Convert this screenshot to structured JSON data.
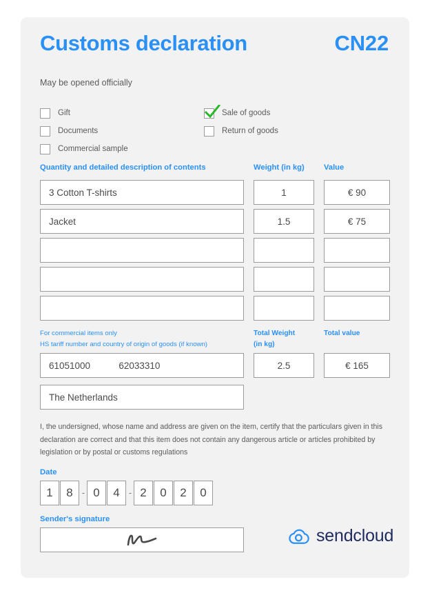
{
  "header": {
    "title": "Customs declaration",
    "code": "CN22",
    "subtitle": "May be opened officially"
  },
  "checkboxes": {
    "left": [
      {
        "label": "Gift",
        "checked": false
      },
      {
        "label": "Documents",
        "checked": false
      },
      {
        "label": "Commercial sample",
        "checked": false
      }
    ],
    "right": [
      {
        "label": "Sale of goods",
        "checked": true
      },
      {
        "label": "Return of goods",
        "checked": false
      }
    ]
  },
  "table": {
    "headers": {
      "description": "Quantity and detailed description of contents",
      "weight": "Weight (in kg)",
      "value": "Value"
    },
    "rows": [
      {
        "description": "3 Cotton T-shirts",
        "weight": "1",
        "value": "€ 90"
      },
      {
        "description": "Jacket",
        "weight": "1.5",
        "value": "€ 75"
      },
      {
        "description": "",
        "weight": "",
        "value": ""
      },
      {
        "description": "",
        "weight": "",
        "value": ""
      },
      {
        "description": "",
        "weight": "",
        "value": ""
      }
    ]
  },
  "commercial": {
    "note_line1": "For commercial items only",
    "note_line2": "HS tariff number and country of origin of goods (if known)",
    "total_weight_label_line1": "Total Weight",
    "total_weight_label_line2": "(in kg)",
    "total_value_label": "Total value",
    "hs_numbers": "61051000           62033310",
    "total_weight": "2.5",
    "total_value": "€ 165",
    "country_of_origin": "The Netherlands"
  },
  "legal_text": "I, the undersigned, whose name and address are given on the item, certify that the particulars given in this declaration are correct and that this item does not contain any dangerous article or articles prohibited by legislation or by postal or customs regulations",
  "date": {
    "label": "Date",
    "digits": [
      "1",
      "8",
      "0",
      "4",
      "2",
      "0",
      "2",
      "0"
    ],
    "separator": "-",
    "value": "18-04-2020"
  },
  "signature": {
    "label": "Sender's signature",
    "mark": "signature-scribble"
  },
  "brand": {
    "name": "sendcloud",
    "logo_icon": "cloud-icon"
  },
  "colors": {
    "accent": "#2a90f5",
    "card_bg": "#f2f2f2",
    "field_border": "#9a9a9a",
    "text": "#5b5b5b",
    "check_green": "#2ab82a",
    "brand_navy": "#1f2a5e"
  }
}
